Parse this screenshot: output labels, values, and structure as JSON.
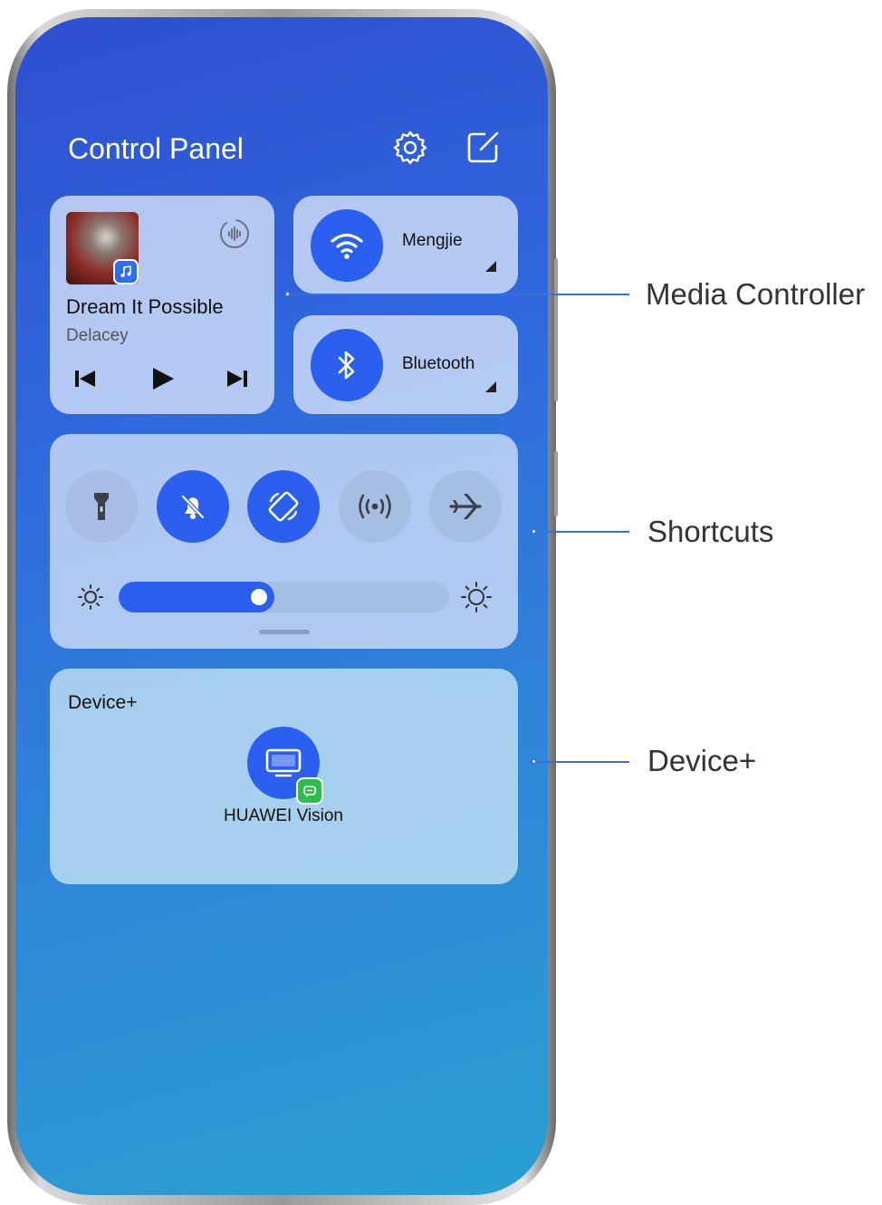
{
  "control_panel": {
    "title": "Control Panel",
    "header_icons": [
      "gear-icon",
      "edit-icon"
    ]
  },
  "media": {
    "song_title": "Dream It Possible",
    "artist": "Delacey",
    "controls": [
      "previous-icon",
      "play-icon",
      "next-icon"
    ],
    "audio_output_icon": "audio-output-icon"
  },
  "wifi": {
    "label": "Mengjie",
    "state": "on"
  },
  "bluetooth": {
    "label": "Bluetooth",
    "state": "on"
  },
  "shortcuts": {
    "toggles": [
      {
        "icon": "flashlight-icon",
        "active": false
      },
      {
        "icon": "bell-off-icon",
        "active": true
      },
      {
        "icon": "auto-rotate-icon",
        "active": true
      },
      {
        "icon": "hotspot-icon",
        "active": false
      },
      {
        "icon": "airplane-icon",
        "active": false
      }
    ],
    "brightness_level": 0.47
  },
  "device_plus": {
    "label": "Device+",
    "device_name": "HUAWEI Vision"
  },
  "callouts": {
    "media_controller": "Media Controller",
    "shortcuts": "Shortcuts",
    "device_plus": "Device+"
  },
  "colors": {
    "accent": "#2a5ff0",
    "callout": "#3a6fd8"
  }
}
